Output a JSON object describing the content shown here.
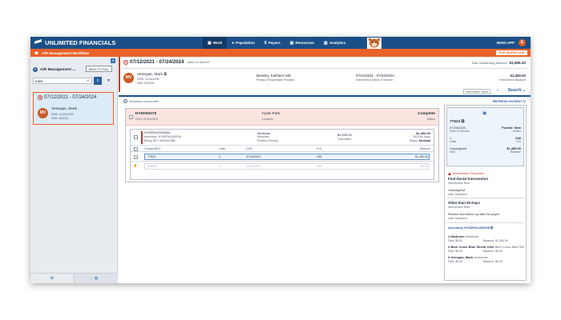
{
  "nav": {
    "brand": "UNLIMITED FINANCIALS",
    "items": [
      {
        "icon": "briefcase-icon",
        "label": "Work",
        "active": true
      },
      {
        "icon": "user-icon",
        "label": "Population",
        "active": false
      },
      {
        "icon": "dollar-icon",
        "label": "Payers",
        "active": false
      },
      {
        "icon": "book-icon",
        "label": "Resources",
        "active": false
      },
      {
        "icon": "chart-icon",
        "label": "Analytics",
        "active": false
      }
    ],
    "app_name": "XDHG-APP",
    "user_initial": "E"
  },
  "workflow_bar": {
    "title": "A/R Management Workflow",
    "exit_label": "EXIT WORKFLOW",
    "accent": "#e8622a"
  },
  "sidebar": {
    "title": "A/R Management ...",
    "back_label": "BACK TO FULL",
    "search_value": "mark",
    "card": {
      "date_range": "07/12/2021 - 07/24/2024",
      "initials": "MV",
      "name": "Venegas, Mark",
      "dob": "DOB: 11/18/1935",
      "pan": "PAN: 543228"
    }
  },
  "header": {
    "date_range": "07/12/2021 - 07/24/2024",
    "date_label": "Dates of Service",
    "total_label": "Total Outstanding Balance",
    "total_value": "$1,555.30",
    "patient_initials": "MV",
    "patient_name": "Venegas, Mark",
    "patient_dob": "DOB: 11/18/1935",
    "patient_pan": "PAN: 543228",
    "provider_name": "Beasley, Kathleen MD",
    "provider_label": "Primary Responsible Provider",
    "intervention_dates": "07/12/2021 - 07/24/2024",
    "intervention_dates_label": "Intervention Dates of Service",
    "intervention_balance": "$1,450.00",
    "intervention_balance_label": "Intervention Balance",
    "intervention_types_label": "Intervention Types",
    "intervention_types_count": "1",
    "search_label": "Search"
  },
  "status": {
    "workflow_connected": "Workflow connected",
    "refresh_label": "REFRESH PATIENT"
  },
  "encounter": {
    "id": "HYD006379",
    "dos": "DOS: 07/24/2024",
    "location": "Hyde Park",
    "location_label": "Location",
    "status": "Complete",
    "status_label": "Status",
    "claim": {
      "id": "HYDEPA1000038A1",
      "assembly": "Assembly: HYDEPA1000038",
      "billing_npi": "Billing NPI: 3653022285",
      "payer1": "Medicare",
      "payer2": "Medicare",
      "position": "Position Primary",
      "total_billed": "$4,633.00",
      "total_billed_label": "Total Billed",
      "balance": "$1,450.00",
      "days": "151/180 Days",
      "status_label": "Status:",
      "status_value": "Nominal"
    },
    "columns": [
      "Charge/NDC",
      "Units",
      "DOS",
      "ICD",
      "Balance"
    ],
    "rows": [
      {
        "charge": "77523",
        "units": "1",
        "dos": "07/24/2024",
        "icd": "C80",
        "balance": "$1,450.00"
      },
      {
        "charge": "SAW22",
        "units": "1",
        "dos": "07/24/2024",
        "icd": "C80",
        "balance": "$0.00"
      }
    ]
  },
  "right_panel": {
    "code": "77523",
    "dos": "07/24/2024",
    "dos_label": "Date of Service",
    "posted": "Posted: New",
    "posted_label": "Status",
    "units": "1",
    "units_label": "Units",
    "icd": "C80",
    "icd_label": "ICD",
    "ndc": "Unassigned",
    "ndc_label": "NDC",
    "balance": "$1,450.00",
    "balance_label": "Balance",
    "intervention_required": "Intervention Required",
    "rule1_title": "Find Denial Intervention",
    "rule1_label": "Intervention Rule",
    "guidance1_value": "Unassigned",
    "guidance1_label": "User Guidance",
    "rule2_title": "Older than 90 Days",
    "rule2_label": "Intervention Rule",
    "guidance2_value": "Review and follow-up with the payer.",
    "guidance2_label": "User Guidance",
    "assembly_label": "Assembly HYDEPA1000038",
    "payers": [
      {
        "name": "1 Medicare",
        "type": "Medicare",
        "paid": "Paid: $0.00",
        "balance": "Balance: $1,450.00"
      },
      {
        "name": "2 Blue Cross Blue Shield Ohio",
        "type": "Blue Cross Blue Shield Ohio",
        "paid": "Paid: $0.00",
        "balance": "Balance: $0.00"
      },
      {
        "name": "3 Venegas, Mark",
        "type": "Guarantor",
        "paid": "Paid: $0.00",
        "balance": "Balance: $0.00"
      }
    ]
  }
}
